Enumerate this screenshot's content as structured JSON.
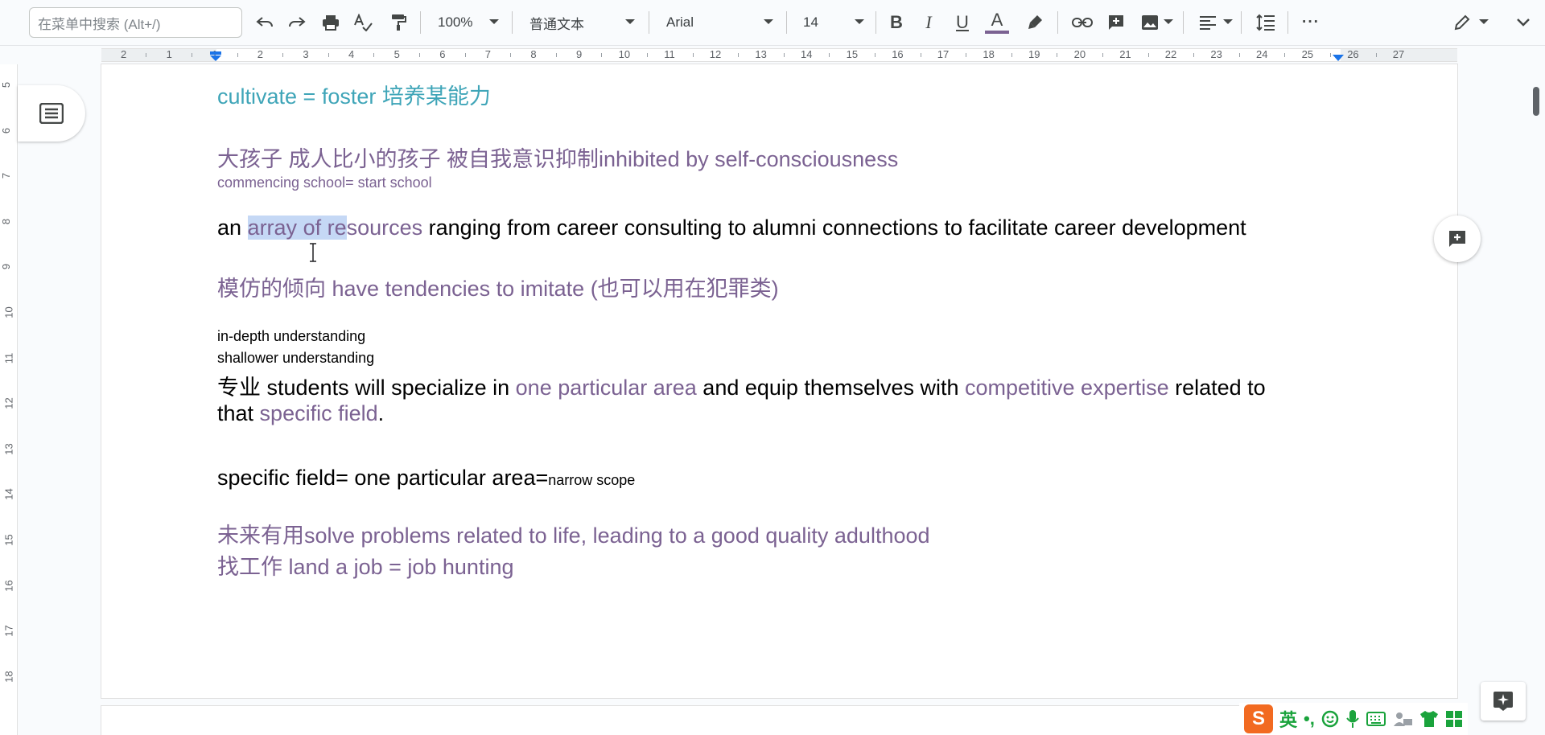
{
  "toolbar": {
    "search_placeholder": "在菜单中搜索 (Alt+/)",
    "zoom": "100%",
    "style": "普通文本",
    "font": "Arial",
    "font_size": "14"
  },
  "ruler": {
    "marks": [
      "2",
      "1",
      "1",
      "2",
      "3",
      "4",
      "5",
      "6",
      "7",
      "8",
      "9",
      "10",
      "11",
      "12",
      "13",
      "14",
      "15",
      "16",
      "17",
      "18",
      "19",
      "20",
      "21",
      "22",
      "23",
      "24",
      "25",
      "26",
      "27"
    ]
  },
  "vruler": {
    "marks": [
      "5",
      "6",
      "7",
      "8",
      "9",
      "10",
      "11",
      "12",
      "13",
      "14",
      "15",
      "16",
      "17",
      "18"
    ]
  },
  "doc": {
    "line1": "cultivate = foster 培养某能力",
    "line2": "大孩子 成人比小的孩子 被自我意识抑制inhibited by self-consciousness",
    "line3": "commencing school= start school",
    "line4_pre": "an ",
    "line4_sel": "array of re",
    "line4_purple": "sources",
    "line4_post": " ranging from career consulting to alumni connections to facilitate career development",
    "line5": "模仿的倾向 have tendencies to imitate (也可以用在犯罪类)",
    "line6": "in-depth understanding",
    "line7": "shallower understanding",
    "line8_a": "专业 students will specialize in ",
    "line8_b": "one particular area",
    "line8_c": " and equip themselves with ",
    "line8_d": "competitive expertise",
    "line8_e": " related to",
    "line9_a": "that ",
    "line9_b": "specific field",
    "line9_c": ".",
    "line10_a": "specific field= one particular area=",
    "line10_b": "narrow scope",
    "line11": "未来有用solve problems related to life, leading to a good quality adulthood",
    "line12": "找工作 land a job = job hunting"
  },
  "ime": {
    "logo": "S",
    "lang": "英",
    "punct": "•,"
  },
  "colors": {
    "purple": "#7b6292",
    "teal": "#3fa5b8",
    "selection": "#c5d8f5"
  }
}
